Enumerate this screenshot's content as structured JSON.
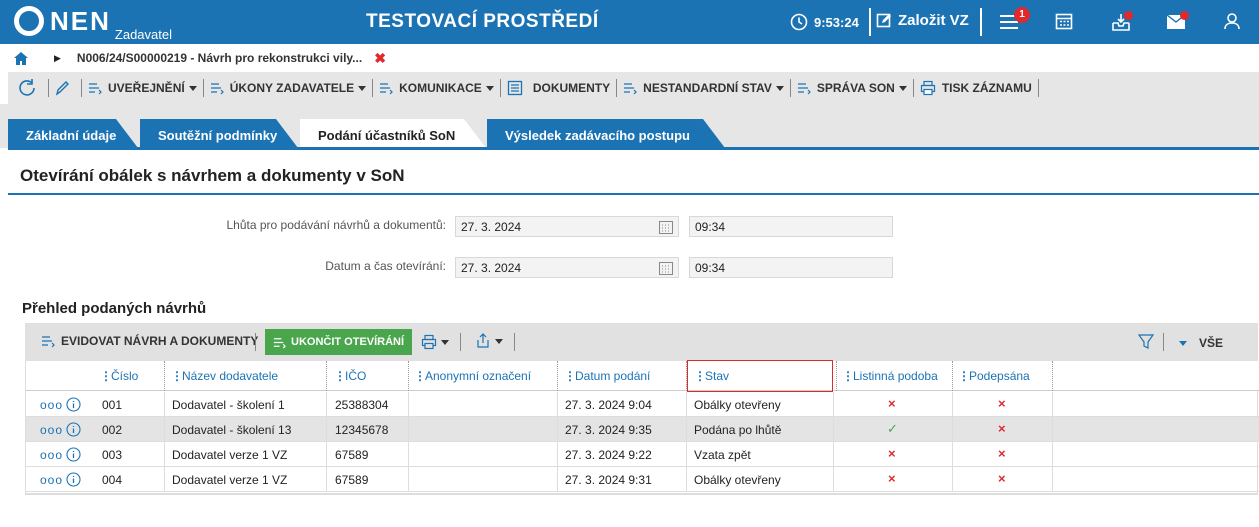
{
  "app": {
    "logo_text": "NEN",
    "logo_sub": "Zadavatel",
    "environment": "TESTOVACÍ PROSTŘEDÍ",
    "time": "9:53:24",
    "create_label": "Založit VZ",
    "notif_count": "1"
  },
  "breadcrumb": {
    "path": "N006/24/S00000219 - Návrh pro rekonstrukci vily..."
  },
  "toolbar": {
    "publish": "UVEŘEJNĚNÍ",
    "actions": "ÚKONY ZADAVATELE",
    "communication": "KOMUNIKACE",
    "documents": "DOKUMENTY",
    "nonstandard": "NESTANDARDNÍ STAV",
    "son_admin": "SPRÁVA SON",
    "print": "TISK ZÁZNAMU"
  },
  "tabs": [
    {
      "label": "Základní údaje"
    },
    {
      "label": "Soutěžní podmínky"
    },
    {
      "label": "Podání účastníků SoN"
    },
    {
      "label": "Výsledek zadávacího postupu"
    }
  ],
  "section": {
    "title": "Otevírání obálek s návrhem a dokumenty v SoN",
    "deadline_label": "Lhůta pro podávání návrhů a dokumentů:",
    "deadline_date": "27. 3. 2024",
    "deadline_time": "09:34",
    "opening_label": "Datum a čas otevírání:",
    "opening_date": "27. 3. 2024",
    "opening_time": "09:34"
  },
  "overview": {
    "title": "Přehled podaných návrhů",
    "register_btn": "EVIDOVAT NÁVRH A DOKUMENTY",
    "finish_btn": "UKONČIT OTEVÍRÁNÍ",
    "filter_all": "VŠE",
    "columns": [
      "Číslo",
      "Název dodavatele",
      "IČO",
      "Anonymní označení",
      "Datum podání",
      "Stav",
      "Listinná podoba",
      "Podepsána"
    ],
    "rows": [
      {
        "num": "001",
        "supplier": "Dodavatel - školení 1",
        "ico": "25388304",
        "anon": "",
        "date": "27. 3. 2024 9:04",
        "status": "Obálky otevřeny",
        "paper": "×",
        "signed": "×"
      },
      {
        "num": "002",
        "supplier": "Dodavatel - školení 13",
        "ico": "12345678",
        "anon": "",
        "date": "27. 3. 2024 9:35",
        "status": "Podána po lhůtě",
        "paper": "✓",
        "signed": "×"
      },
      {
        "num": "003",
        "supplier": "Dodavatel verze 1 VZ",
        "ico": "67589",
        "anon": "",
        "date": "27. 3. 2024 9:22",
        "status": "Vzata zpět",
        "paper": "×",
        "signed": "×"
      },
      {
        "num": "004",
        "supplier": "Dodavatel verze 1 VZ",
        "ico": "67589",
        "anon": "",
        "date": "27. 3. 2024 9:31",
        "status": "Obálky otevřeny",
        "paper": "×",
        "signed": "×"
      }
    ]
  }
}
